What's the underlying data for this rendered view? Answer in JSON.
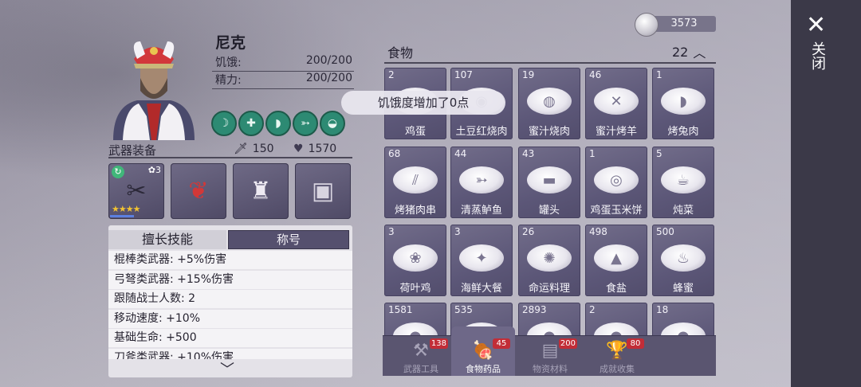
{
  "character": {
    "name": "尼克",
    "stats": [
      {
        "label": "饥饿:",
        "value": "200/200"
      },
      {
        "label": "精力:",
        "value": "200/200"
      }
    ]
  },
  "equipment": {
    "title": "武器装备",
    "attack": "150",
    "defense": "1570",
    "weapon_level": "3",
    "weapon_stars": 4
  },
  "skills_panel": {
    "tabs": [
      "擅长技能",
      "称号"
    ],
    "rows": [
      "棍棒类武器: +5%伤害",
      "弓弩类武器: +15%伤害",
      "跟随战士人数: 2",
      "移动速度: +10%",
      "基础生命: +500",
      "刀斧类武器: +10%伤害"
    ]
  },
  "currency": {
    "value": "3573"
  },
  "inventory": {
    "category": "食物",
    "count": "22",
    "items": [
      {
        "count": "2",
        "name": "鸡蛋"
      },
      {
        "count": "107",
        "name": "土豆红烧肉"
      },
      {
        "count": "19",
        "name": "蜜汁烧肉"
      },
      {
        "count": "46",
        "name": "蜜汁烤羊"
      },
      {
        "count": "1",
        "name": "烤兔肉"
      },
      {
        "count": "68",
        "name": "烤猪肉串"
      },
      {
        "count": "44",
        "name": "清蒸鲈鱼"
      },
      {
        "count": "43",
        "name": "罐头"
      },
      {
        "count": "1",
        "name": "鸡蛋玉米饼"
      },
      {
        "count": "5",
        "name": "炖菜"
      },
      {
        "count": "3",
        "name": "荷叶鸡"
      },
      {
        "count": "3",
        "name": "海鲜大餐"
      },
      {
        "count": "26",
        "name": "命运料理"
      },
      {
        "count": "498",
        "name": "食盐"
      },
      {
        "count": "500",
        "name": "蜂蜜"
      },
      {
        "count": "1581",
        "name": ""
      },
      {
        "count": "535",
        "name": ""
      },
      {
        "count": "2893",
        "name": ""
      },
      {
        "count": "2",
        "name": ""
      },
      {
        "count": "18",
        "name": ""
      }
    ]
  },
  "tooltip": "饥饿度增加了0点",
  "bottom_tabs": [
    {
      "label": "武器工具",
      "badge": "138",
      "icon": "hammer-icon"
    },
    {
      "label": "食物药品",
      "badge": "45",
      "icon": "food-icon"
    },
    {
      "label": "物资材料",
      "badge": "200",
      "icon": "log-icon"
    },
    {
      "label": "成就收集",
      "badge": "80",
      "icon": "trophy-icon"
    }
  ],
  "close_label": "关闭",
  "colors": {
    "accent_panel": "#5c5778",
    "badge_red": "#c22d37",
    "skill_green": "#2d8a73"
  }
}
